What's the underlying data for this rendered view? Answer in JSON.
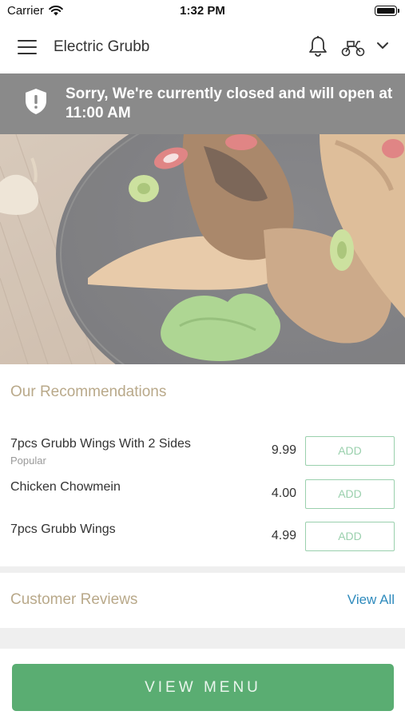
{
  "status_bar": {
    "carrier": "Carrier",
    "time": "1:32 PM"
  },
  "nav": {
    "title": "Electric Grubb"
  },
  "banner": {
    "message": "Sorry, We're currently closed and will open at 11:00 AM"
  },
  "recommendations": {
    "title": "Our Recommendations",
    "items": [
      {
        "name": "7pcs Grubb Wings With 2 Sides",
        "tag": "Popular",
        "price": "9.99",
        "add_label": "ADD"
      },
      {
        "name": "Chicken Chowmein",
        "tag": "",
        "price": "4.00",
        "add_label": "ADD"
      },
      {
        "name": "7pcs Grubb Wings",
        "tag": "",
        "price": "4.99",
        "add_label": "ADD"
      }
    ]
  },
  "reviews": {
    "title": "Customer Reviews",
    "view_all_label": "View All"
  },
  "footer": {
    "view_menu_label": "VIEW MENU"
  },
  "colors": {
    "banner_bg": "#8a8a8a",
    "section_title": "#b9a98a",
    "add_border": "#9ad0ad",
    "link": "#2f8bbd",
    "primary_button": "#5aad72"
  },
  "icons": [
    "menu-icon",
    "bell-icon",
    "scooter-icon",
    "chevron-down-icon",
    "shield-alert-icon",
    "wifi-icon",
    "battery-icon"
  ]
}
